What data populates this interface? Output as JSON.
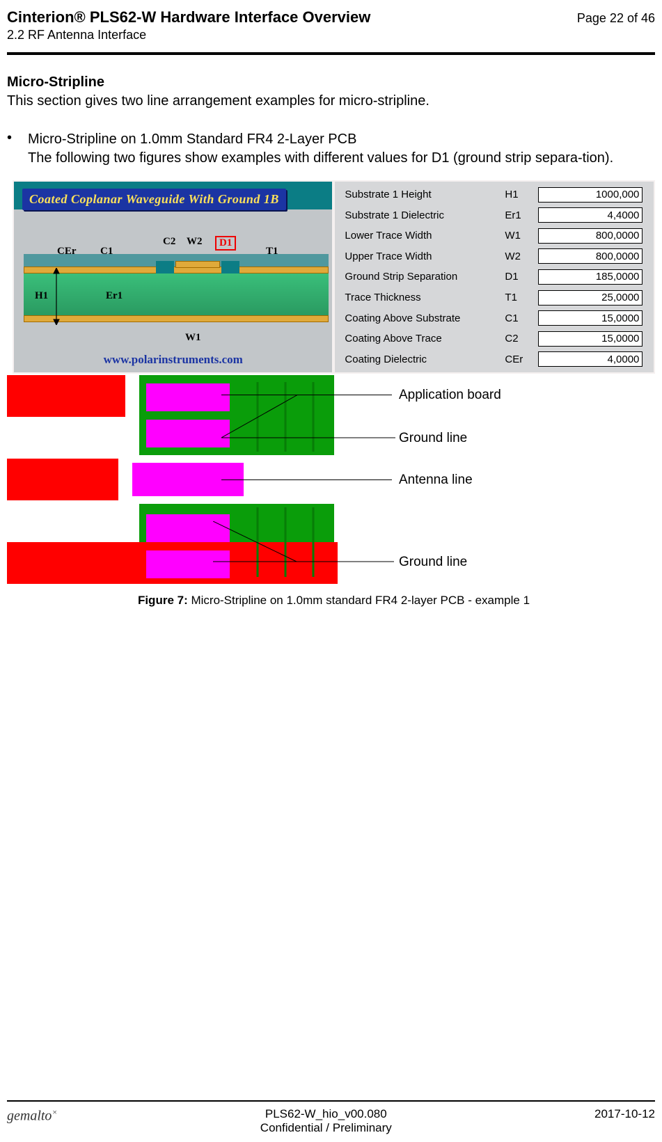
{
  "header": {
    "title": "Cinterion® PLS62-W Hardware Interface Overview",
    "page_indicator": "Page 22 of 46",
    "section": "2.2 RF Antenna Interface"
  },
  "body": {
    "heading": "Micro-Stripline",
    "intro": "This section gives two line arrangement examples for micro-stripline.",
    "bullet_title": "Micro-Stripline on 1.0mm Standard FR4 2-Layer PCB",
    "bullet_text": "The following two figures show examples with different values for D1 (ground strip separa-tion)."
  },
  "waveguide": {
    "title": "Coated Coplanar Waveguide With Ground 1B",
    "labels": {
      "CEr": "CEr",
      "C1": "C1",
      "C2": "C2",
      "W2": "W2",
      "D1": "D1",
      "T1": "T1",
      "H1": "H1",
      "Er1": "Er1",
      "W1": "W1"
    },
    "url": "www.polarinstruments.com"
  },
  "params": [
    {
      "label": "Substrate 1 Height",
      "sym": "H1",
      "val": "1000,000"
    },
    {
      "label": "Substrate 1 Dielectric",
      "sym": "Er1",
      "val": "4,4000"
    },
    {
      "label": "Lower Trace Width",
      "sym": "W1",
      "val": "800,0000"
    },
    {
      "label": "Upper Trace Width",
      "sym": "W2",
      "val": "800,0000"
    },
    {
      "label": "Ground Strip Separation",
      "sym": "D1",
      "val": "185,0000"
    },
    {
      "label": "Trace Thickness",
      "sym": "T1",
      "val": "25,0000"
    },
    {
      "label": "Coating Above Substrate",
      "sym": "C1",
      "val": "15,0000"
    },
    {
      "label": "Coating Above Trace",
      "sym": "C2",
      "val": "15,0000"
    },
    {
      "label": "Coating Dielectric",
      "sym": "CEr",
      "val": "4,0000"
    }
  ],
  "annotations": {
    "app_board": "Application board",
    "ground_line_top": "Ground line",
    "antenna_line": "Antenna line",
    "ground_line_bot": "Ground line"
  },
  "caption": {
    "lead": "Figure 7:  ",
    "text": "Micro-Stripline on 1.0mm standard FR4 2-layer PCB - example 1"
  },
  "footer": {
    "logo": "gemalto",
    "docnum": "PLS62-W_hio_v00.080",
    "confidential": "Confidential / Preliminary",
    "date": "2017-10-12"
  },
  "chart_data": {
    "type": "table",
    "title": "Coated Coplanar Waveguide With Ground 1B — parameters",
    "rows": [
      {
        "parameter": "Substrate 1 Height",
        "symbol": "H1",
        "value": 1000.0,
        "raw": "1000,000"
      },
      {
        "parameter": "Substrate 1 Dielectric",
        "symbol": "Er1",
        "value": 4.4,
        "raw": "4,4000"
      },
      {
        "parameter": "Lower Trace Width",
        "symbol": "W1",
        "value": 800.0,
        "raw": "800,0000"
      },
      {
        "parameter": "Upper Trace Width",
        "symbol": "W2",
        "value": 800.0,
        "raw": "800,0000"
      },
      {
        "parameter": "Ground Strip Separation",
        "symbol": "D1",
        "value": 185.0,
        "raw": "185,0000"
      },
      {
        "parameter": "Trace Thickness",
        "symbol": "T1",
        "value": 25.0,
        "raw": "25,0000"
      },
      {
        "parameter": "Coating Above Substrate",
        "symbol": "C1",
        "value": 15.0,
        "raw": "15,0000"
      },
      {
        "parameter": "Coating Above Trace",
        "symbol": "C2",
        "value": 15.0,
        "raw": "15,0000"
      },
      {
        "parameter": "Coating Dielectric",
        "symbol": "CEr",
        "value": 4.0,
        "raw": "4,0000"
      }
    ]
  }
}
